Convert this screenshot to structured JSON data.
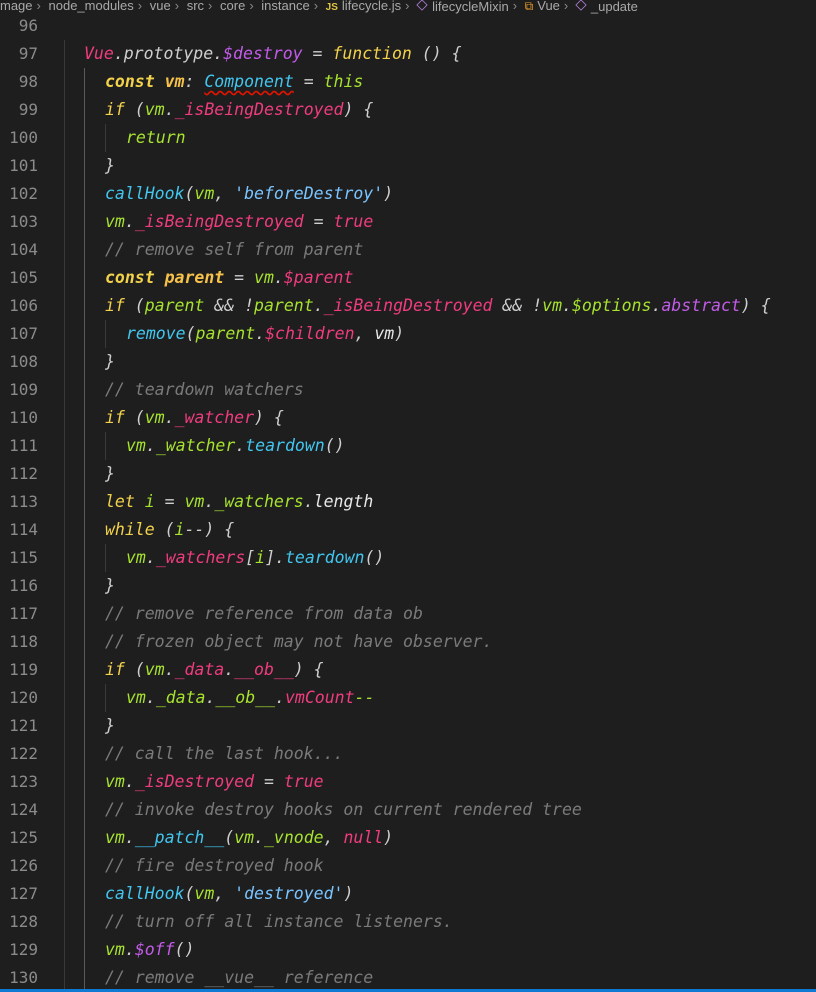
{
  "breadcrumb": {
    "items": [
      "mage",
      "node_modules",
      "vue",
      "src",
      "core",
      "instance",
      "lifecycle.js",
      "lifecycleMixin",
      "Vue",
      "_update"
    ],
    "js_badge": "JS"
  },
  "editor": {
    "lines": [
      {
        "n": "96",
        "t": []
      },
      {
        "n": "97",
        "t": [
          [
            "r",
            "Vue"
          ],
          [
            "pn",
            "."
          ],
          [
            "pn",
            "prototype"
          ],
          [
            "pn",
            "."
          ],
          [
            "p",
            "$destroy"
          ],
          [
            "pn",
            " = "
          ],
          [
            "k",
            "function"
          ],
          [
            "pn",
            " () {"
          ]
        ]
      },
      {
        "n": "98",
        "t": [
          [
            "kf",
            "const"
          ],
          [
            "pn",
            " "
          ],
          [
            "o",
            "vm"
          ],
          [
            "pn",
            ": "
          ],
          [
            "b err",
            "Component"
          ],
          [
            "pn",
            " = "
          ],
          [
            "g",
            "this"
          ]
        ]
      },
      {
        "n": "99",
        "t": [
          [
            "k",
            "if"
          ],
          [
            "pn",
            " ("
          ],
          [
            "g",
            "vm"
          ],
          [
            "pn",
            "."
          ],
          [
            "r",
            "_isBeingDestroyed"
          ],
          [
            "pn",
            ") {"
          ]
        ]
      },
      {
        "n": "100",
        "t": [
          [
            "g",
            "return"
          ]
        ]
      },
      {
        "n": "101",
        "t": [
          [
            "pn",
            "}"
          ]
        ]
      },
      {
        "n": "102",
        "t": [
          [
            "b",
            "callHook"
          ],
          [
            "pn",
            "("
          ],
          [
            "g",
            "vm"
          ],
          [
            "pn",
            ", "
          ],
          [
            "s",
            "'beforeDestroy'"
          ],
          [
            "pn",
            ")"
          ]
        ]
      },
      {
        "n": "103",
        "t": [
          [
            "g",
            "vm"
          ],
          [
            "pn",
            "."
          ],
          [
            "r",
            "_isBeingDestroyed"
          ],
          [
            "pn",
            " = "
          ],
          [
            "r",
            "true"
          ]
        ]
      },
      {
        "n": "104",
        "t": [
          [
            "c",
            "// remove self from parent"
          ]
        ]
      },
      {
        "n": "105",
        "t": [
          [
            "kf",
            "const"
          ],
          [
            "pn",
            " "
          ],
          [
            "o",
            "parent"
          ],
          [
            "pn",
            " = "
          ],
          [
            "g",
            "vm"
          ],
          [
            "pn",
            "."
          ],
          [
            "r",
            "$parent"
          ]
        ]
      },
      {
        "n": "106",
        "t": [
          [
            "k",
            "if"
          ],
          [
            "pn",
            " ("
          ],
          [
            "g",
            "parent"
          ],
          [
            "pn",
            " && !"
          ],
          [
            "g",
            "parent"
          ],
          [
            "pn",
            "."
          ],
          [
            "r",
            "_isBeingDestroyed"
          ],
          [
            "pn",
            " && !"
          ],
          [
            "g",
            "vm"
          ],
          [
            "pn",
            "."
          ],
          [
            "g",
            "$options"
          ],
          [
            "pn",
            "."
          ],
          [
            "p",
            "abstract"
          ],
          [
            "pn",
            ") {"
          ]
        ]
      },
      {
        "n": "107",
        "t": [
          [
            "b",
            "remove"
          ],
          [
            "pn",
            "("
          ],
          [
            "g",
            "parent"
          ],
          [
            "pn",
            "."
          ],
          [
            "r",
            "$children"
          ],
          [
            "pn",
            ", "
          ],
          [
            "w",
            "vm"
          ],
          [
            "pn",
            ")"
          ]
        ]
      },
      {
        "n": "108",
        "t": [
          [
            "pn",
            "}"
          ]
        ]
      },
      {
        "n": "109",
        "t": [
          [
            "c",
            "// teardown watchers"
          ]
        ]
      },
      {
        "n": "110",
        "t": [
          [
            "k",
            "if"
          ],
          [
            "pn",
            " ("
          ],
          [
            "g",
            "vm"
          ],
          [
            "pn",
            "."
          ],
          [
            "r",
            "_watcher"
          ],
          [
            "pn",
            ") {"
          ]
        ]
      },
      {
        "n": "111",
        "t": [
          [
            "g",
            "vm"
          ],
          [
            "pn",
            "."
          ],
          [
            "g",
            "_watcher"
          ],
          [
            "pn",
            "."
          ],
          [
            "b",
            "teardown"
          ],
          [
            "pn",
            "()"
          ]
        ]
      },
      {
        "n": "112",
        "t": [
          [
            "pn",
            "}"
          ]
        ]
      },
      {
        "n": "113",
        "t": [
          [
            "k",
            "let"
          ],
          [
            "pn",
            " "
          ],
          [
            "g",
            "i"
          ],
          [
            "pn",
            " = "
          ],
          [
            "g",
            "vm"
          ],
          [
            "pn",
            "."
          ],
          [
            "g",
            "_watchers"
          ],
          [
            "pn",
            "."
          ],
          [
            "w",
            "length"
          ]
        ]
      },
      {
        "n": "114",
        "t": [
          [
            "k",
            "while"
          ],
          [
            "pn",
            " ("
          ],
          [
            "g",
            "i"
          ],
          [
            "pn",
            "--) {"
          ]
        ]
      },
      {
        "n": "115",
        "t": [
          [
            "g",
            "vm"
          ],
          [
            "pn",
            "."
          ],
          [
            "r",
            "_watchers"
          ],
          [
            "pn",
            "["
          ],
          [
            "g",
            "i"
          ],
          [
            "pn",
            "]."
          ],
          [
            "b",
            "teardown"
          ],
          [
            "pn",
            "()"
          ]
        ]
      },
      {
        "n": "116",
        "t": [
          [
            "pn",
            "}"
          ]
        ]
      },
      {
        "n": "117",
        "t": [
          [
            "c",
            "// remove reference from data ob"
          ]
        ]
      },
      {
        "n": "118",
        "t": [
          [
            "c",
            "// frozen object may not have observer."
          ]
        ]
      },
      {
        "n": "119",
        "t": [
          [
            "k",
            "if"
          ],
          [
            "pn",
            " ("
          ],
          [
            "g",
            "vm"
          ],
          [
            "pn",
            "."
          ],
          [
            "r",
            "_data"
          ],
          [
            "pn",
            "."
          ],
          [
            "r",
            "__ob__"
          ],
          [
            "pn",
            ") {"
          ]
        ]
      },
      {
        "n": "120",
        "t": [
          [
            "g",
            "vm"
          ],
          [
            "pn",
            "."
          ],
          [
            "g",
            "_data"
          ],
          [
            "pn",
            "."
          ],
          [
            "g",
            "__ob__"
          ],
          [
            "pn",
            "."
          ],
          [
            "r",
            "vmCount"
          ],
          [
            "g",
            "--"
          ]
        ]
      },
      {
        "n": "121",
        "t": [
          [
            "pn",
            "}"
          ]
        ]
      },
      {
        "n": "122",
        "t": [
          [
            "c",
            "// call the last hook..."
          ]
        ]
      },
      {
        "n": "123",
        "t": [
          [
            "g",
            "vm"
          ],
          [
            "pn",
            "."
          ],
          [
            "r",
            "_isDestroyed"
          ],
          [
            "pn",
            " = "
          ],
          [
            "r",
            "true"
          ]
        ]
      },
      {
        "n": "124",
        "t": [
          [
            "c",
            "// invoke destroy hooks on current rendered tree"
          ]
        ]
      },
      {
        "n": "125",
        "t": [
          [
            "g",
            "vm"
          ],
          [
            "pn",
            "."
          ],
          [
            "b",
            "__patch__"
          ],
          [
            "pn",
            "("
          ],
          [
            "g",
            "vm"
          ],
          [
            "pn",
            "."
          ],
          [
            "g",
            "_vnode"
          ],
          [
            "pn",
            ", "
          ],
          [
            "r",
            "null"
          ],
          [
            "pn",
            ")"
          ]
        ]
      },
      {
        "n": "126",
        "t": [
          [
            "c",
            "// fire destroyed hook"
          ]
        ]
      },
      {
        "n": "127",
        "t": [
          [
            "b",
            "callHook"
          ],
          [
            "pn",
            "("
          ],
          [
            "g",
            "vm"
          ],
          [
            "pn",
            ", "
          ],
          [
            "s",
            "'destroyed'"
          ],
          [
            "pn",
            ")"
          ]
        ]
      },
      {
        "n": "128",
        "t": [
          [
            "c",
            "// turn off all instance listeners."
          ]
        ]
      },
      {
        "n": "129",
        "t": [
          [
            "g",
            "vm"
          ],
          [
            "pn",
            "."
          ],
          [
            "p",
            "$off"
          ],
          [
            "pn",
            "()"
          ]
        ]
      },
      {
        "n": "130",
        "t": [
          [
            "c",
            "// remove __vue__ reference"
          ]
        ]
      }
    ]
  }
}
